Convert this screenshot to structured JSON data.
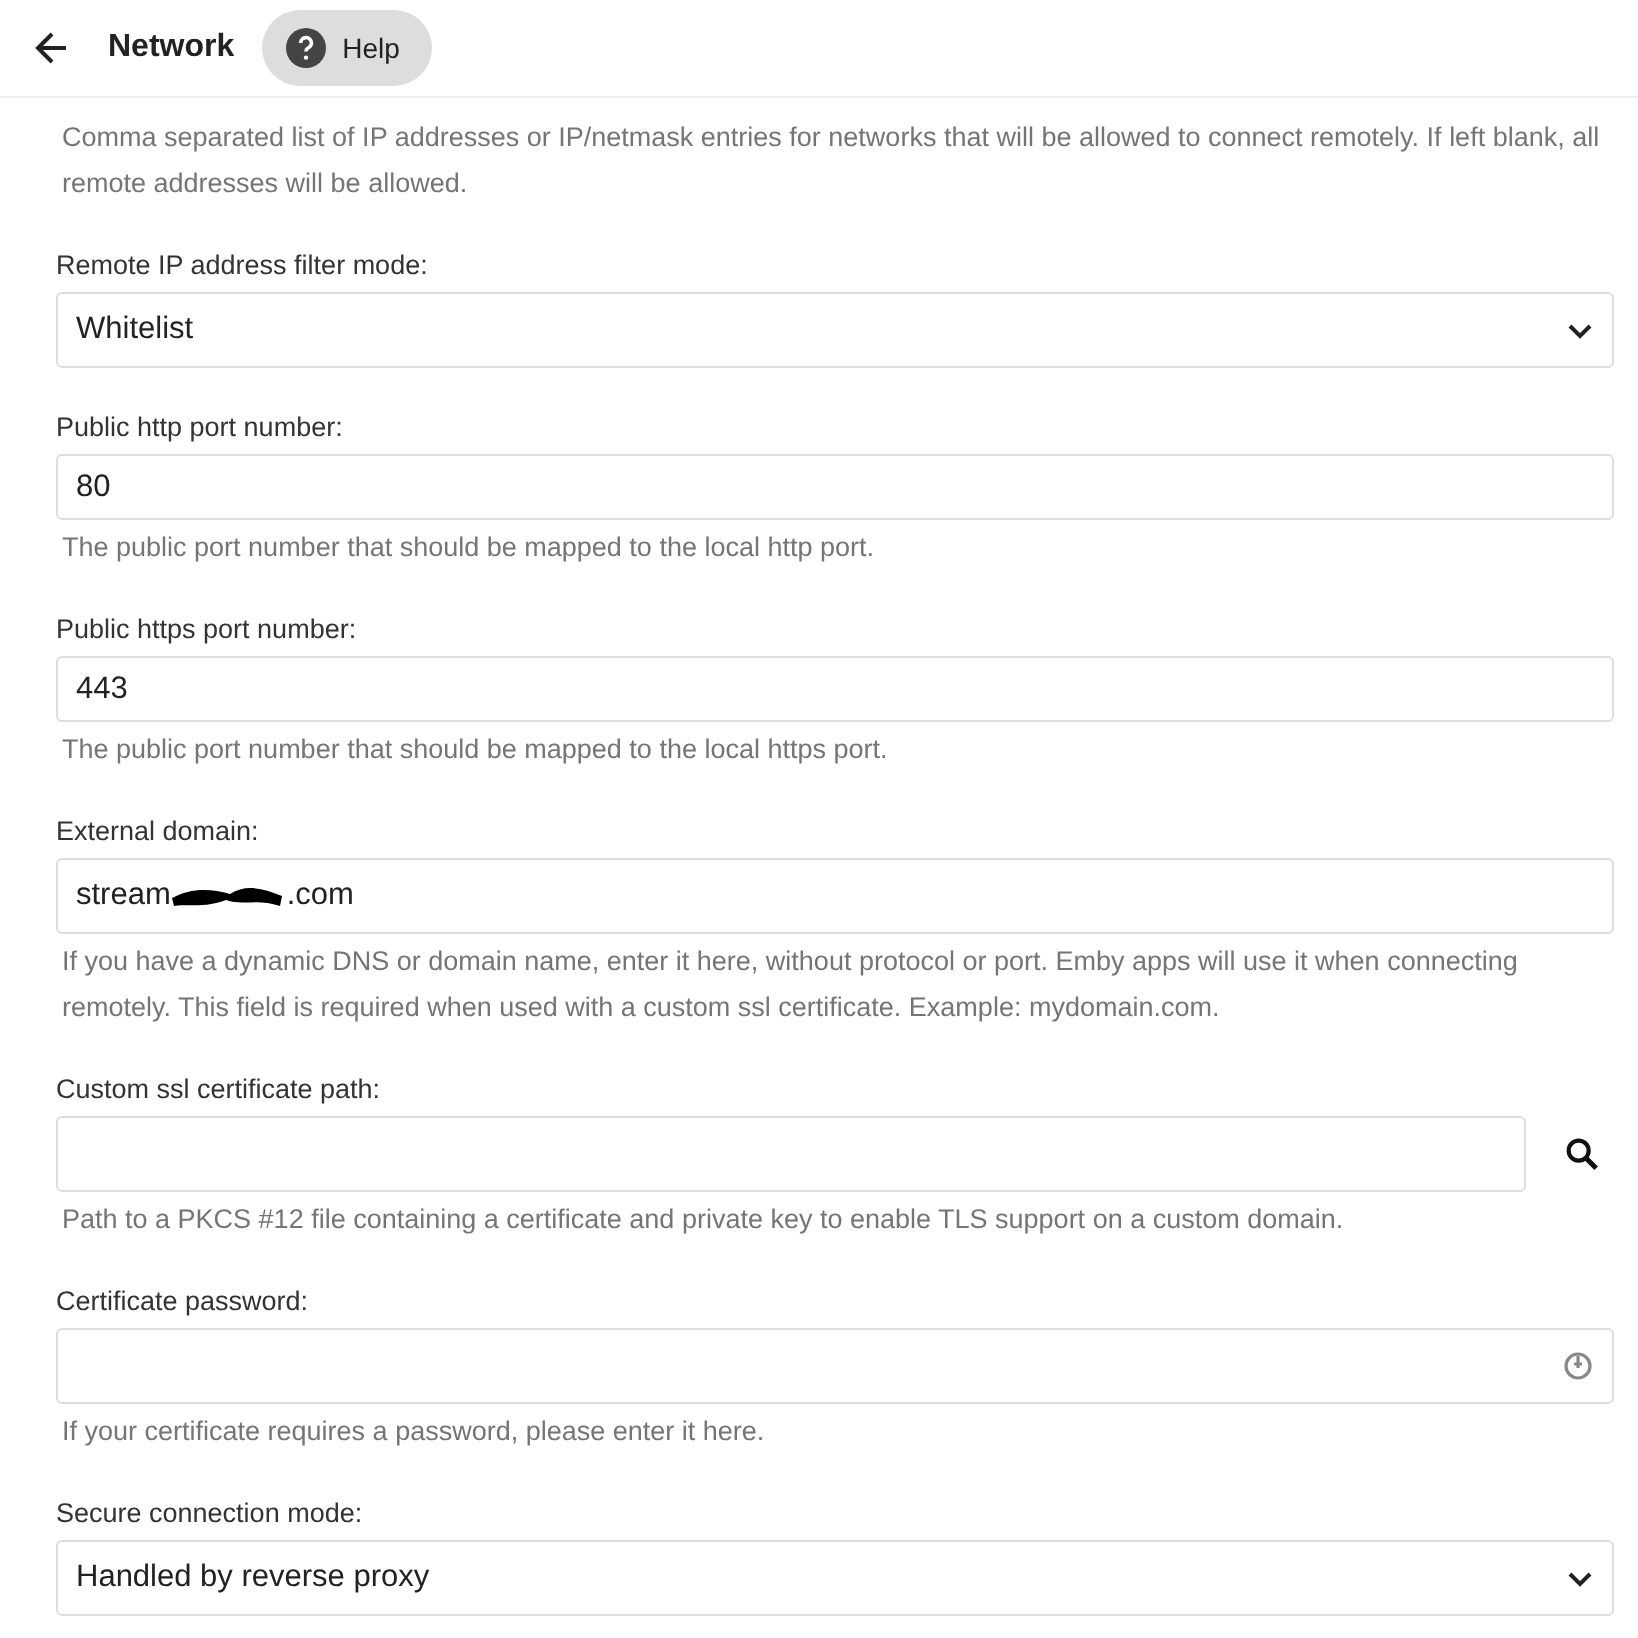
{
  "header": {
    "title": "Network",
    "help_button": "Help"
  },
  "intro_description": "Comma separated list of IP addresses or IP/netmask entries for networks that will be allowed to connect remotely. If left blank, all remote addresses will be allowed.",
  "fields": [
    {
      "kind": "select",
      "label": "Remote IP address filter mode:",
      "value": "Whitelist"
    },
    {
      "kind": "text",
      "label": "Public http port number:",
      "value": "80",
      "description": "The public port number that should be mapped to the local http port."
    },
    {
      "kind": "text",
      "label": "Public https port number:",
      "value": "443",
      "description": "The public port number that should be mapped to the local https port."
    },
    {
      "kind": "redacted",
      "label": "External domain:",
      "value_start": "stream",
      "value_end": ".com",
      "description": "If you have a dynamic DNS or domain name, enter it here, without protocol or port. Emby apps will use it when connecting remotely. This field is required when used with a custom ssl certificate. Example: mydomain.com."
    },
    {
      "kind": "browse",
      "label": "Custom ssl certificate path:",
      "description": "Path to a PKCS #12 file containing a certificate and private key to enable TLS support on a custom domain."
    },
    {
      "kind": "password",
      "label": "Certificate password:",
      "description": "If your certificate requires a password, please enter it here."
    },
    {
      "kind": "select",
      "label": "Secure connection mode:",
      "value": "Handled by reverse proxy"
    }
  ]
}
